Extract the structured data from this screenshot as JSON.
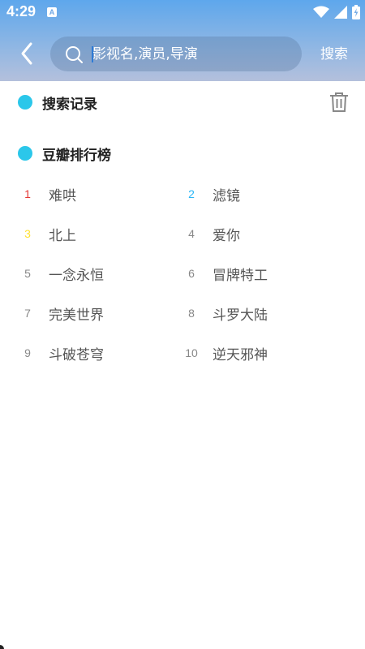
{
  "status_bar": {
    "time": "4:29",
    "notification_badge": "A"
  },
  "search": {
    "placeholder": "影视名,演员,导演",
    "value": "",
    "button_label": "搜索"
  },
  "history": {
    "title": "搜索记录"
  },
  "ranking": {
    "title": "豆瓣排行榜",
    "items": [
      {
        "rank": "1",
        "title": "难哄",
        "color": "#e53935"
      },
      {
        "rank": "2",
        "title": "滤镜",
        "color": "#29b6f6"
      },
      {
        "rank": "3",
        "title": "北上",
        "color": "#ffe135"
      },
      {
        "rank": "4",
        "title": "爱你",
        "color": "#888888"
      },
      {
        "rank": "5",
        "title": "一念永恒",
        "color": "#888888"
      },
      {
        "rank": "6",
        "title": "冒牌特工",
        "color": "#888888"
      },
      {
        "rank": "7",
        "title": "完美世界",
        "color": "#888888"
      },
      {
        "rank": "8",
        "title": "斗罗大陆",
        "color": "#888888"
      },
      {
        "rank": "9",
        "title": "斗破苍穹",
        "color": "#888888"
      },
      {
        "rank": "10",
        "title": "逆天邪神",
        "color": "#888888"
      }
    ]
  },
  "colors": {
    "accent_dot": "#2bc7ea",
    "header_top": "#5ea7ec",
    "header_bottom": "#b4c0dc"
  }
}
